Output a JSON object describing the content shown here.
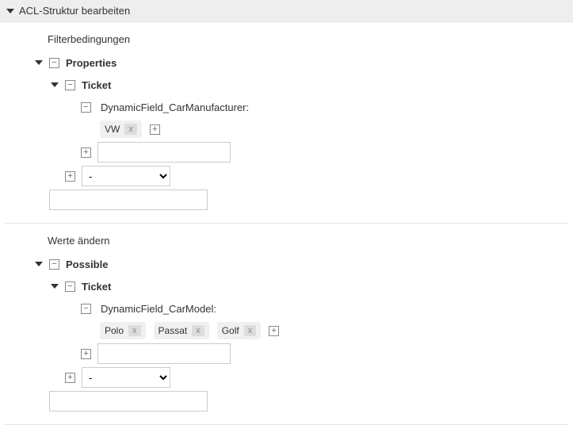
{
  "header": {
    "title": "ACL-Struktur bearbeiten"
  },
  "filter": {
    "heading": "Filterbedingungen",
    "properties_label": "Properties",
    "ticket_label": "Ticket",
    "field_label": "DynamicField_CarManufacturer:",
    "tags": {
      "t0": "VW"
    },
    "select_placeholder": "-"
  },
  "change": {
    "heading": "Werte ändern",
    "possible_label": "Possible",
    "ticket_label": "Ticket",
    "field_label": "DynamicField_CarModel:",
    "tags": {
      "t0": "Polo",
      "t1": "Passat",
      "t2": "Golf"
    },
    "select_placeholder": "-"
  },
  "tag_remove": "x"
}
